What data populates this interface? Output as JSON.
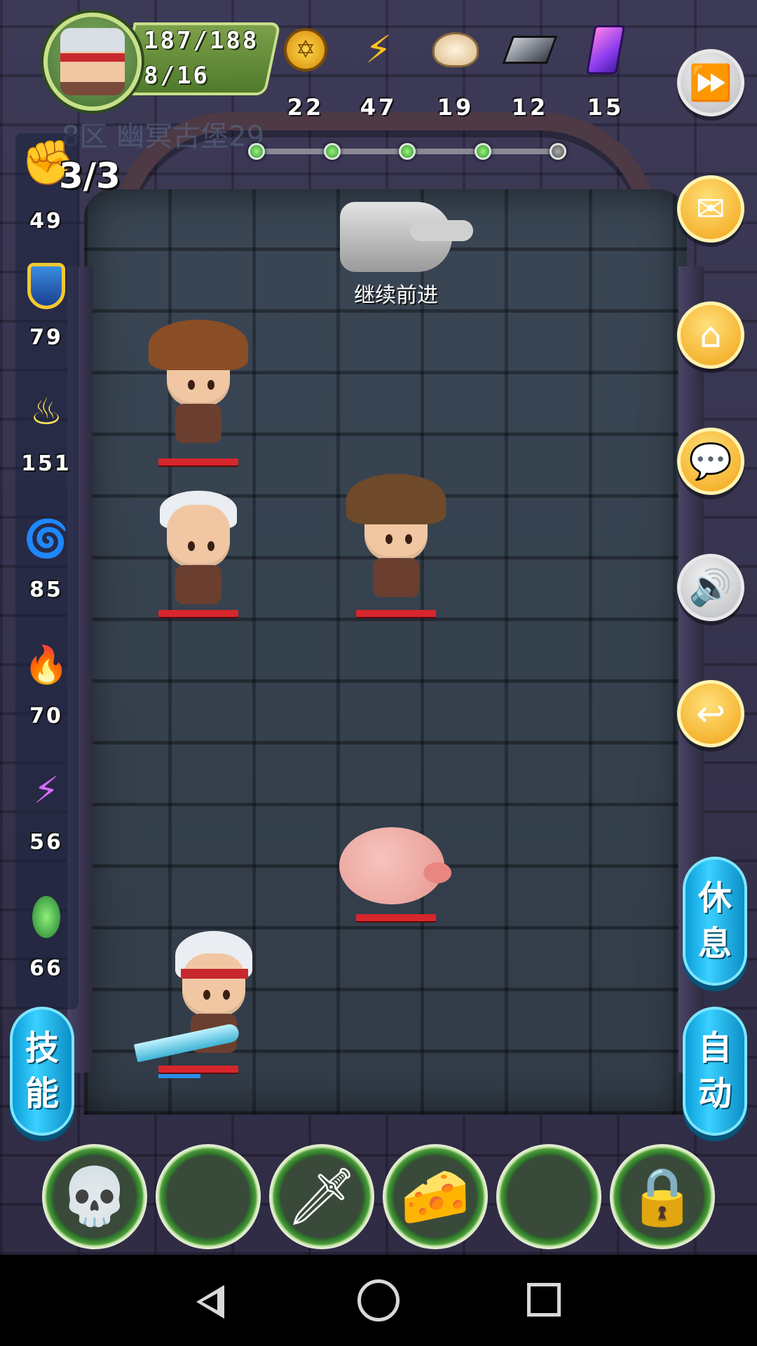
{
  "header": {
    "hp": "187/188",
    "level": "8/16",
    "location_faded": "8区 幽冥古堡29",
    "resources": [
      {
        "name": "gold-coin",
        "icon": "gold-coin-icon",
        "value": "22"
      },
      {
        "name": "energy",
        "icon": "lightning-icon",
        "value": "47"
      },
      {
        "name": "food",
        "icon": "dumpling-icon",
        "value": "19"
      },
      {
        "name": "iron",
        "icon": "iron-ingot-icon",
        "value": "12"
      },
      {
        "name": "gem",
        "icon": "crystal-icon",
        "value": "15"
      }
    ],
    "stage_progress": {
      "completed": 4,
      "total": 5
    }
  },
  "left_stats": {
    "attempts": "3/3",
    "items": [
      {
        "icon": "fist-icon",
        "value": "49"
      },
      {
        "icon": "shield-icon",
        "value": "79"
      },
      {
        "icon": "holy-flame-icon",
        "value": "151"
      },
      {
        "icon": "water-wave-icon",
        "value": "85"
      },
      {
        "icon": "fire-icon",
        "value": "70"
      },
      {
        "icon": "lightning-bolt-icon",
        "value": "56"
      },
      {
        "icon": "poison-icon",
        "value": "66"
      }
    ]
  },
  "hint": {
    "text": "继续前进"
  },
  "right_buttons": {
    "rest": [
      "休",
      "息"
    ],
    "auto": [
      "自",
      "动"
    ],
    "skill": [
      "技",
      "能"
    ]
  },
  "slots": [
    {
      "icon": "skull-icon",
      "glyph": "💀"
    },
    {
      "icon": "empty-slot",
      "glyph": ""
    },
    {
      "icon": "sword-icon",
      "glyph": "🗡"
    },
    {
      "icon": "cheese-icon",
      "glyph": "🧀"
    },
    {
      "icon": "empty-slot",
      "glyph": ""
    },
    {
      "icon": "lock-icon",
      "glyph": "🔒"
    }
  ],
  "colors": {
    "accent_blue": "#22b8ec",
    "button_gold": "#f2a316",
    "hp_red": "#d8262d"
  }
}
